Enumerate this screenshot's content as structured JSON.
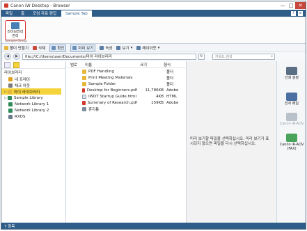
{
  "app": {
    "title": "Canon iW Desktop - Browser"
  },
  "window_controls": {
    "minimize": "—",
    "maximize": "□",
    "close": "✕"
  },
  "menu": {
    "items": [
      "파일",
      "홈",
      "모임 자료 편집",
      "Sample Tab"
    ],
    "active_index": 3,
    "right_icons": [
      "help-icon",
      "settings-icon"
    ],
    "right_labels": [
      "?",
      "≡"
    ]
  },
  "ribbon": {
    "button_label": "라이브러리 관리",
    "group_label": "Sample Group"
  },
  "toolbar": {
    "new_folder": "폴더 만들기",
    "delete": "삭제",
    "check": "확인",
    "preview_mode": "미리 보기",
    "properties": "속성",
    "view": "보기",
    "layout": "레이아웃"
  },
  "address": {
    "path": "file:///C:/Users/user/Documents/마이 라이브러리",
    "search_placeholder": "키워드 검색"
  },
  "left_panel": {
    "title": "라이브러리",
    "tree": [
      {
        "label": "내 프레이",
        "icon": "library-icon",
        "color": "#e0a020"
      },
      {
        "label": "체크 아웃",
        "icon": "checkout-icon",
        "color": "#7a7a7a"
      },
      {
        "label": "마이 라이브러리",
        "icon": "folder-icon",
        "color": "#e7b73c",
        "selected": true
      },
      {
        "label": "Sample Library",
        "icon": "library-icon",
        "color": "#2e8b57"
      },
      {
        "label": "Network Library 1",
        "icon": "network-library-icon",
        "color": "#2e8b57"
      },
      {
        "label": "Network Library 2",
        "icon": "network-library-icon",
        "color": "#2e8b57"
      },
      {
        "label": "RXDS",
        "icon": "library-icon",
        "color": "#6a7b8c"
      }
    ]
  },
  "file_list": {
    "headers": {
      "col0": "범로",
      "name": "이름",
      "size": "크기",
      "type": "형식"
    },
    "rows": [
      {
        "name": "PDF Handling",
        "size": "",
        "type": "폴더",
        "icon": "folder-icon"
      },
      {
        "name": "Print Meeting Materials",
        "size": "",
        "type": "폴더",
        "icon": "folder-icon"
      },
      {
        "name": "Sample Folder",
        "size": "",
        "type": "폴더",
        "icon": "folder-icon"
      },
      {
        "name": "Desktop for Beginners.pdf",
        "size": "11,786KB",
        "type": "Adobe",
        "icon": "pdf-icon"
      },
      {
        "name": "IWDT Startup Guide.html",
        "size": "4KB",
        "type": "HTML",
        "icon": "html-icon"
      },
      {
        "name": "Summary of Research.pdf",
        "size": "159KB",
        "type": "Adobe",
        "icon": "pdf-icon"
      },
      {
        "name": "휴지통",
        "size": "",
        "type": "",
        "icon": "trash-icon"
      }
    ]
  },
  "preview": {
    "message": "미리 보기할 파일을 선택하십시오. 미리 보기가 표시되지 않으면 파일을 다시 선택하십시오."
  },
  "right_panel": {
    "items": [
      {
        "label": "인쇄 설정",
        "icon": "print-settings-icon",
        "color": "#5a6e84",
        "enabled": true
      },
      {
        "label": "전자 메일",
        "icon": "email-icon",
        "color": "#4a6fa0",
        "enabled": true
      },
      {
        "label": "Canon iR-ADV",
        "icon": "printer-icon",
        "color": "#b9c1ca",
        "enabled": false
      },
      {
        "label": "Canon iR-ADV (FAX)",
        "icon": "fax-icon",
        "color": "#4aa35a",
        "enabled": true
      }
    ]
  },
  "status": {
    "text": "7 항목"
  }
}
